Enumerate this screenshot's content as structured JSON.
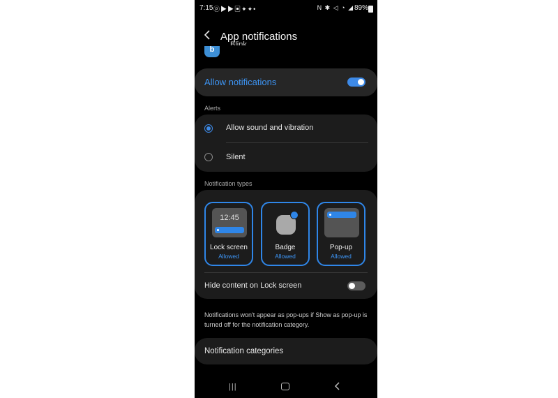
{
  "status_bar": {
    "time": "7:15",
    "battery": "89%",
    "left_icons": [
      "pinterest-icon",
      "youtube-icon",
      "youtube-icon",
      "news-icon",
      "twitter-icon",
      "twitter-icon",
      "dot-icon"
    ],
    "right_icons": [
      "nfc-icon",
      "bluetooth-icon",
      "mute-icon",
      "wifi-icon",
      "signal-icon",
      "battery-icon"
    ]
  },
  "header": {
    "title": "App notifications",
    "back_icon": "chevron-left-icon"
  },
  "app": {
    "name": "Blink",
    "icon_letter": "b"
  },
  "allow": {
    "label": "Allow notifications",
    "toggle_on": true
  },
  "alerts": {
    "section_label": "Alerts",
    "options": [
      {
        "label": "Allow sound and vibration",
        "selected": true
      },
      {
        "label": "Silent",
        "selected": false
      }
    ]
  },
  "notification_types": {
    "section_label": "Notification types",
    "lock_clock": "12:45",
    "types": [
      {
        "name": "Lock screen",
        "status": "Allowed"
      },
      {
        "name": "Badge",
        "status": "Allowed"
      },
      {
        "name": "Pop-up",
        "status": "Allowed"
      }
    ],
    "hide_content": {
      "label": "Hide content on Lock screen",
      "toggle_on": false
    }
  },
  "note": "Notifications won't appear as pop-ups if Show as pop-up is turned off for the notification category.",
  "categories": {
    "label": "Notification categories"
  },
  "colors": {
    "accent": "#3d8ae8",
    "background": "#000000",
    "card": "#1c1c1c"
  }
}
